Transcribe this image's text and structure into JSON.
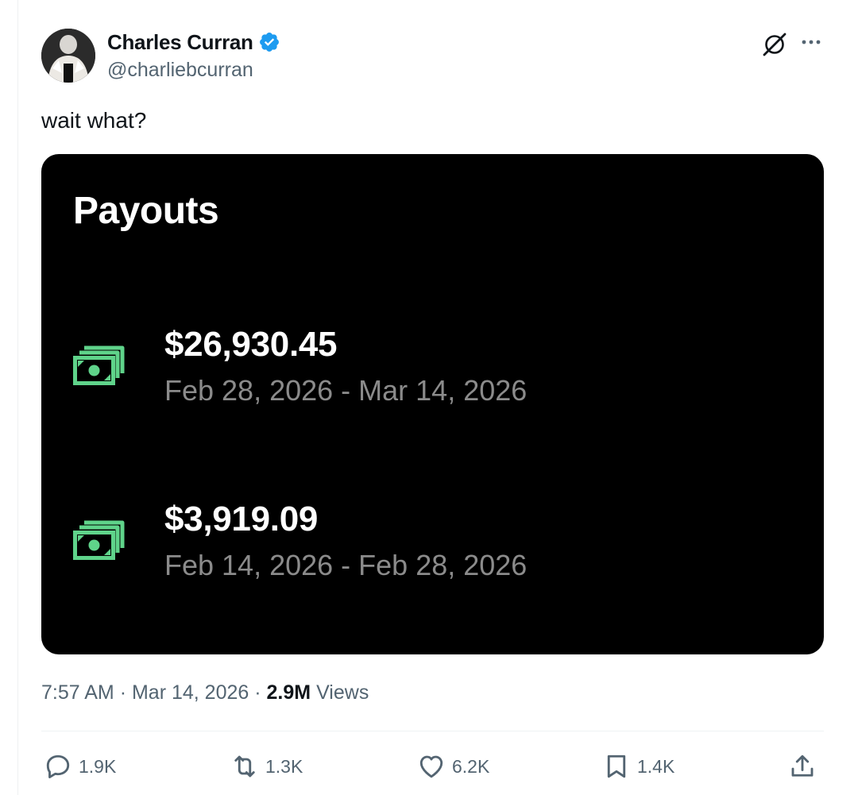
{
  "author": {
    "display_name": "Charles Curran",
    "handle": "@charliebcurran",
    "verified": true
  },
  "tweet": {
    "text": "wait what?"
  },
  "media": {
    "title": "Payouts",
    "payouts": [
      {
        "amount": "$26,930.45",
        "period": "Feb 28, 2026 - Mar 14, 2026",
        "icon": "money-icon"
      },
      {
        "amount": "$3,919.09",
        "period": "Feb 14, 2026 - Feb 28, 2026",
        "icon": "money-icon"
      }
    ]
  },
  "meta": {
    "time": "7:57 AM",
    "separator": "·",
    "date": "Mar 14, 2026",
    "views_count": "2.9M",
    "views_label": "Views"
  },
  "actions": {
    "replies": "1.9K",
    "reposts": "1.3K",
    "likes": "6.2K",
    "bookmarks": "1.4K"
  },
  "colors": {
    "verified_blue": "#1d9bf0",
    "money_green": "#5fd38a",
    "text_secondary": "#536471",
    "media_background": "#000000"
  }
}
